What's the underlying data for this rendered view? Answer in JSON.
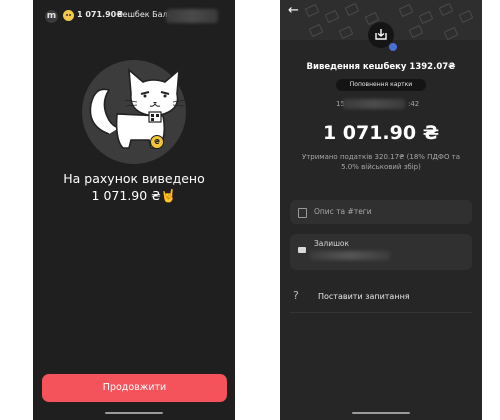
{
  "left_screen": {
    "top_bar": {
      "avatar_letter": "m",
      "amount": "1 071.90₴",
      "label": "Кешбек Балан"
    },
    "illustration": "cat-character",
    "coin_badge": "₴",
    "withdrawn_line1": "На рахунок виведено",
    "withdrawn_line2": "1 071.90 ₴🤘",
    "continue_button": "Продовжити"
  },
  "right_screen": {
    "back_icon": "←",
    "title": "Виведення кешбеку 1392.07₴",
    "category_pill": "Поповнення картки",
    "date_prefix": "15",
    "date_suffix": ":42",
    "amount": "1 071.90 ₴",
    "tax_note": "Утримано податків 320.17₴ (18% ПДФО та 5.0% військовий збір)",
    "description_placeholder": "Опис та #теги",
    "balance_label": "Залишок",
    "ask_question": "Поставити запитання"
  },
  "colors": {
    "accent_button": "#f4535b",
    "screen_bg": "#1f1f1f",
    "card_bg": "#303030"
  }
}
